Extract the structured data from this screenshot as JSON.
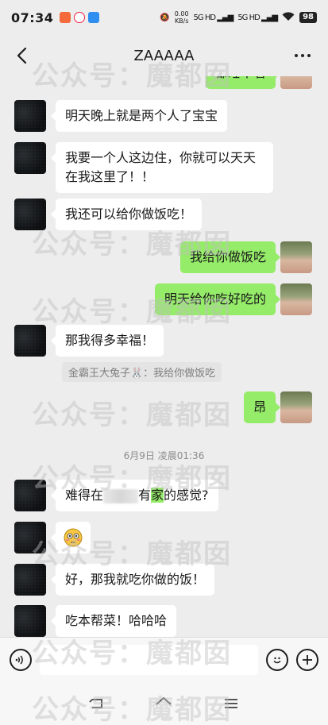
{
  "status": {
    "time": "07:34",
    "net_speed_value": "0.00",
    "net_speed_unit": "KB/s",
    "net_label_1": "5G HD",
    "net_label_2": "5G HD",
    "battery": "98"
  },
  "header": {
    "title": "ZAAAAA"
  },
  "messages": [
    {
      "id": "m0",
      "side": "right",
      "text": "都睡不着"
    },
    {
      "id": "m1",
      "side": "left",
      "text": "明天晚上就是两个人了宝宝"
    },
    {
      "id": "m2",
      "side": "left",
      "line1": "我要一个人这边住，你就可以天天",
      "line2": "在我这里了！！"
    },
    {
      "id": "m3",
      "side": "left",
      "text": "我还可以给你做饭吃！"
    },
    {
      "id": "m4",
      "side": "right",
      "text": "我给你做饭吃"
    },
    {
      "id": "m5",
      "side": "right",
      "text": "明天给你吃好吃的"
    },
    {
      "id": "m6",
      "side": "left",
      "text": "那我得多幸福！"
    },
    {
      "id": "m7",
      "side": "right",
      "text": "昂"
    },
    {
      "id": "m8",
      "side": "left",
      "pre": "难得在",
      "mid": "有",
      "hl": "家",
      "post": "的感觉?"
    },
    {
      "id": "m9",
      "side": "left",
      "emoji": "flushed-face"
    },
    {
      "id": "m10",
      "side": "left",
      "text": "好，那我就吃你做的饭！"
    },
    {
      "id": "m11",
      "side": "left",
      "text": "吃本帮菜！哈哈哈"
    }
  ],
  "quote": {
    "text": "金霸王大兔子🐰：我给你做饭吃"
  },
  "timestamp": "6月9日 凌晨01:36",
  "watermark": "公众号：魔都囡",
  "colors": {
    "bubble_right": "#95ec69",
    "bubble_left": "#ffffff",
    "background": "#ededed"
  },
  "icons": {
    "back": "back-arrow-icon",
    "more": "more-dots-icon",
    "voice": "voice-icon",
    "emoji": "emoji-icon",
    "plus": "plus-icon"
  }
}
